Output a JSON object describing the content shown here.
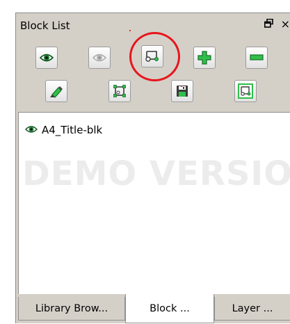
{
  "panel": {
    "title": "Block List",
    "float_icon": "restore-icon",
    "close_label": "×"
  },
  "toolbar": {
    "row1": [
      {
        "name": "show-block-button",
        "icon": "eye-icon"
      },
      {
        "name": "hide-block-button",
        "icon": "eye-icon"
      },
      {
        "name": "insert-block-button",
        "icon": "insert-block-icon",
        "highlighted": true
      },
      {
        "name": "add-block-button",
        "icon": "plus-icon"
      },
      {
        "name": "remove-block-button",
        "icon": "minus-icon"
      }
    ],
    "row2": [
      {
        "name": "edit-block-button",
        "icon": "pencil-icon"
      },
      {
        "name": "create-block-button",
        "icon": "create-block-icon"
      },
      {
        "name": "save-block-button",
        "icon": "save-icon"
      },
      {
        "name": "save-block-as-button",
        "icon": "save-as-icon"
      }
    ]
  },
  "blocks": [
    {
      "name": "A4_Title-blk",
      "visible": true
    }
  ],
  "watermark": "DEMO VERSION",
  "tabs": [
    {
      "label": "Library Brow...",
      "active": false
    },
    {
      "label": "Block ...",
      "active": true
    },
    {
      "label": "Layer ...",
      "active": false
    }
  ],
  "colors": {
    "panel_bg": "#d4d0c8",
    "highlight_ring": "#e8161c",
    "icon_green": "#2fbf4a"
  }
}
